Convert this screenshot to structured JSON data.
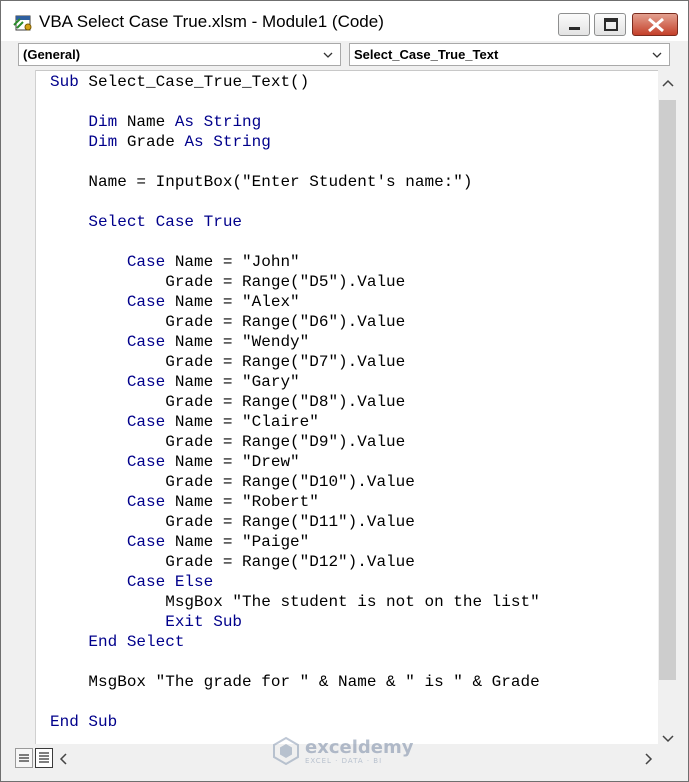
{
  "window": {
    "title": "VBA Select Case True.xlsm - Module1 (Code)",
    "icon": "vba-module-icon"
  },
  "combos": {
    "object": "(General)",
    "procedure": "Select_Case_True_Text"
  },
  "colors": {
    "keyword": "#00008b",
    "text": "#000000",
    "close_button": "#c4402a"
  },
  "code_lines": [
    [
      {
        "t": "Sub",
        "k": true
      },
      {
        "t": " Select_Case_True_Text()"
      }
    ],
    [],
    [
      {
        "t": "    "
      },
      {
        "t": "Dim",
        "k": true
      },
      {
        "t": " Name "
      },
      {
        "t": "As",
        "k": true
      },
      {
        "t": " "
      },
      {
        "t": "String",
        "k": true
      }
    ],
    [
      {
        "t": "    "
      },
      {
        "t": "Dim",
        "k": true
      },
      {
        "t": " Grade "
      },
      {
        "t": "As",
        "k": true
      },
      {
        "t": " "
      },
      {
        "t": "String",
        "k": true
      }
    ],
    [],
    [
      {
        "t": "    Name = InputBox(\"Enter Student's name:\")"
      }
    ],
    [],
    [
      {
        "t": "    "
      },
      {
        "t": "Select Case True",
        "k": true
      }
    ],
    [],
    [
      {
        "t": "        "
      },
      {
        "t": "Case",
        "k": true
      },
      {
        "t": " Name = \"John\""
      }
    ],
    [
      {
        "t": "            Grade = Range(\"D5\").Value"
      }
    ],
    [
      {
        "t": "        "
      },
      {
        "t": "Case",
        "k": true
      },
      {
        "t": " Name = \"Alex\""
      }
    ],
    [
      {
        "t": "            Grade = Range(\"D6\").Value"
      }
    ],
    [
      {
        "t": "        "
      },
      {
        "t": "Case",
        "k": true
      },
      {
        "t": " Name = \"Wendy\""
      }
    ],
    [
      {
        "t": "            Grade = Range(\"D7\").Value"
      }
    ],
    [
      {
        "t": "        "
      },
      {
        "t": "Case",
        "k": true
      },
      {
        "t": " Name = \"Gary\""
      }
    ],
    [
      {
        "t": "            Grade = Range(\"D8\").Value"
      }
    ],
    [
      {
        "t": "        "
      },
      {
        "t": "Case",
        "k": true
      },
      {
        "t": " Name = \"Claire\""
      }
    ],
    [
      {
        "t": "            Grade = Range(\"D9\").Value"
      }
    ],
    [
      {
        "t": "        "
      },
      {
        "t": "Case",
        "k": true
      },
      {
        "t": " Name = \"Drew\""
      }
    ],
    [
      {
        "t": "            Grade = Range(\"D10\").Value"
      }
    ],
    [
      {
        "t": "        "
      },
      {
        "t": "Case",
        "k": true
      },
      {
        "t": " Name = \"Robert\""
      }
    ],
    [
      {
        "t": "            Grade = Range(\"D11\").Value"
      }
    ],
    [
      {
        "t": "        "
      },
      {
        "t": "Case",
        "k": true
      },
      {
        "t": " Name = \"Paige\""
      }
    ],
    [
      {
        "t": "            Grade = Range(\"D12\").Value"
      }
    ],
    [
      {
        "t": "        "
      },
      {
        "t": "Case Else",
        "k": true
      }
    ],
    [
      {
        "t": "            MsgBox \"The student is not on the list\""
      }
    ],
    [
      {
        "t": "            "
      },
      {
        "t": "Exit Sub",
        "k": true
      }
    ],
    [
      {
        "t": "    "
      },
      {
        "t": "End Select",
        "k": true
      }
    ],
    [],
    [
      {
        "t": "    MsgBox \"The grade for \" & Name & \" is \" & Grade"
      }
    ],
    [],
    [
      {
        "t": "End Sub",
        "k": true
      }
    ]
  ],
  "watermark": {
    "name": "exceldemy",
    "tagline": "EXCEL · DATA · BI"
  }
}
